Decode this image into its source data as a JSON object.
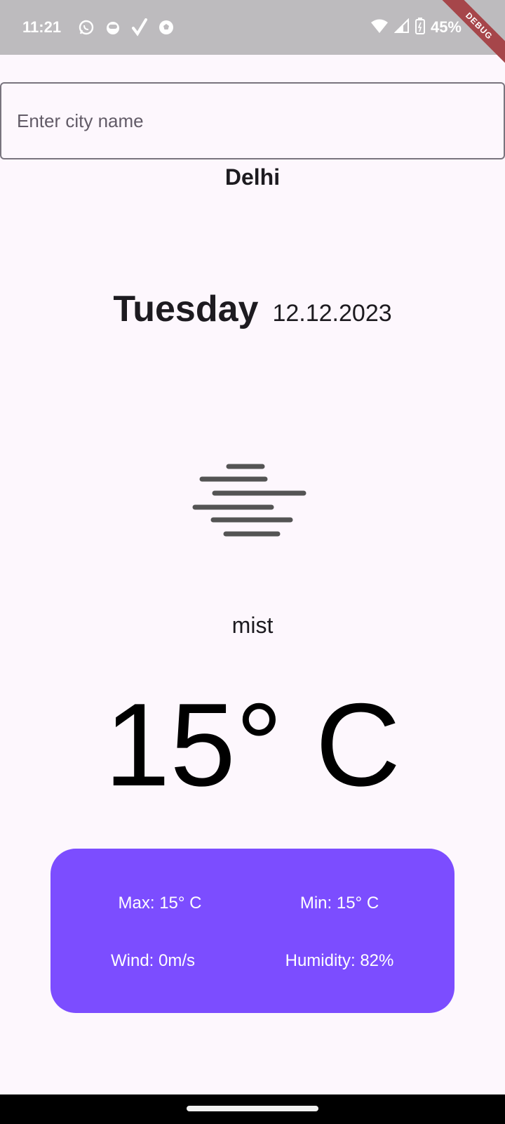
{
  "status_bar": {
    "time": "11:21",
    "notification_icons": [
      "whatsapp-icon",
      "app-icon",
      "check-icon",
      "soccer-ball-icon"
    ],
    "battery_percent": "45%",
    "debug_banner": "DEBUG"
  },
  "search": {
    "placeholder": "Enter city name",
    "value": ""
  },
  "weather": {
    "city": "Delhi",
    "day": "Tuesday",
    "date": "12.12.2023",
    "icon": "mist-icon",
    "description": "mist",
    "temperature": "15° C"
  },
  "details": {
    "max": "Max: 15° C",
    "min": "Min: 15° C",
    "wind": "Wind: 0m/s",
    "humidity": "Humidity: 82%"
  },
  "colors": {
    "accent": "#7c4dff",
    "background": "#fdf7fd",
    "status_bar": "#bdbbbe",
    "debug_banner": "#a6464a"
  }
}
